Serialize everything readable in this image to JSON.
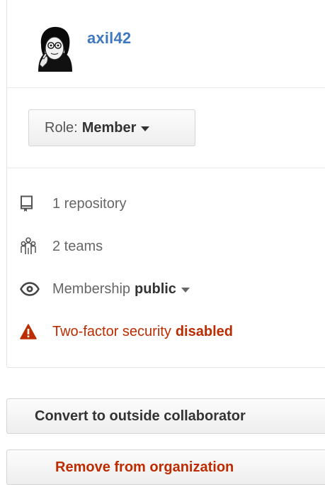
{
  "member": {
    "username": "axil42",
    "avatar_icon": "user-avatar"
  },
  "role": {
    "prefix": "Role:",
    "value": "Member"
  },
  "details": {
    "repositories": {
      "icon": "repo-icon",
      "text": "1 repository"
    },
    "teams": {
      "icon": "people-icon",
      "text": "2 teams"
    },
    "membership": {
      "icon": "eye-icon",
      "label": "Membership",
      "value": "public"
    },
    "two_factor": {
      "icon": "alert-icon",
      "label": "Two-factor security",
      "value": "disabled"
    }
  },
  "actions": {
    "convert_label": "Convert to outside collaborator",
    "remove_label": "Remove from organization"
  },
  "colors": {
    "link": "#4078c0",
    "danger": "#bd2c00",
    "muted": "#666666"
  }
}
